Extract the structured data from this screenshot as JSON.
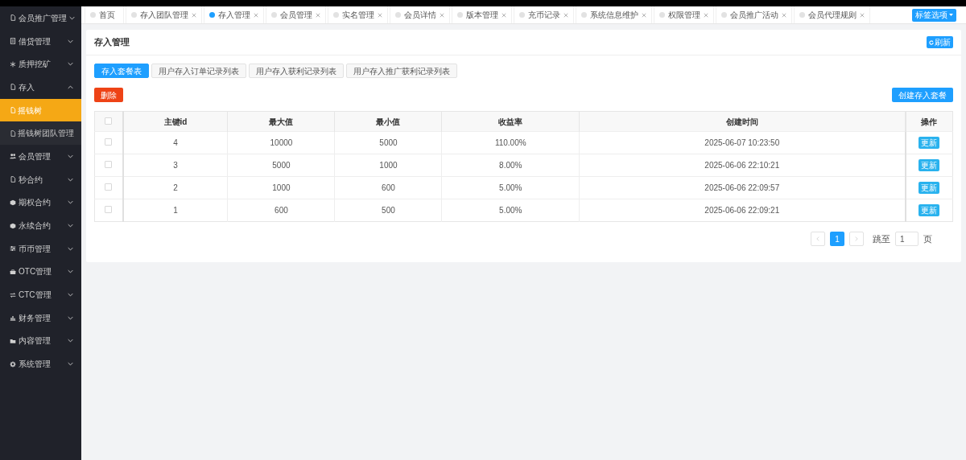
{
  "sidebar": {
    "items": [
      {
        "label": "会员推广管理",
        "kind": "file",
        "expanded": false,
        "selected": false
      },
      {
        "label": "借贷管理",
        "kind": "ledger",
        "expanded": false,
        "selected": false
      },
      {
        "label": "质押挖矿",
        "kind": "asterisk",
        "expanded": false,
        "selected": false
      },
      {
        "label": "存入",
        "kind": "file",
        "expanded": true,
        "selected": false,
        "children": [
          {
            "label": "摇钱树",
            "kind": "file",
            "selected": true
          },
          {
            "label": "摇钱树团队管理",
            "kind": "file",
            "selected": false
          }
        ]
      },
      {
        "label": "会员管理",
        "kind": "users",
        "expanded": false,
        "selected": false
      },
      {
        "label": "秒合约",
        "kind": "file",
        "expanded": false,
        "selected": false
      },
      {
        "label": "期权合约",
        "kind": "cube",
        "expanded": false,
        "selected": false
      },
      {
        "label": "永续合约",
        "kind": "cube",
        "expanded": false,
        "selected": false
      },
      {
        "label": "币币管理",
        "kind": "sliders",
        "expanded": false,
        "selected": false
      },
      {
        "label": "OTC管理",
        "kind": "briefcase",
        "expanded": false,
        "selected": false
      },
      {
        "label": "CTC管理",
        "kind": "exchange",
        "expanded": false,
        "selected": false
      },
      {
        "label": "财务管理",
        "kind": "chart",
        "expanded": false,
        "selected": false
      },
      {
        "label": "内容管理",
        "kind": "folder",
        "expanded": false,
        "selected": false
      },
      {
        "label": "系统管理",
        "kind": "gear",
        "expanded": false,
        "selected": false
      }
    ]
  },
  "tabs": [
    {
      "label": "首页",
      "selected": false,
      "closable": false
    },
    {
      "label": "存入团队管理",
      "selected": false,
      "closable": true
    },
    {
      "label": "存入管理",
      "selected": true,
      "closable": true
    },
    {
      "label": "会员管理",
      "selected": false,
      "closable": true
    },
    {
      "label": "实名管理",
      "selected": false,
      "closable": true
    },
    {
      "label": "会员详情",
      "selected": false,
      "closable": true
    },
    {
      "label": "版本管理",
      "selected": false,
      "closable": true
    },
    {
      "label": "充币记录",
      "selected": false,
      "closable": true
    },
    {
      "label": "系统信息维护",
      "selected": false,
      "closable": true
    },
    {
      "label": "权限管理",
      "selected": false,
      "closable": true
    },
    {
      "label": "会员推广活动",
      "selected": false,
      "closable": true
    },
    {
      "label": "会员代理规则",
      "selected": false,
      "closable": true
    }
  ],
  "tab_options_button": "标签选项",
  "panel": {
    "title": "存入管理",
    "refresh_button": "刷新"
  },
  "sub_tabs": [
    {
      "label": "存入套餐表",
      "selected": true
    },
    {
      "label": "用户存入订单记录列表",
      "selected": false
    },
    {
      "label": "用户存入获利记录列表",
      "selected": false
    },
    {
      "label": "用户存入推广获利记录列表",
      "selected": false
    }
  ],
  "delete_button": "删除",
  "create_button": "创建存入套餐",
  "table": {
    "all_checked": false,
    "columns": [
      "主键id",
      "最大值",
      "最小值",
      "收益率",
      "创建时间",
      "操作"
    ],
    "rows": [
      {
        "checked": false,
        "cells": [
          "4",
          "10000",
          "5000",
          "110.00%",
          "2025-06-07 10:23:50"
        ],
        "action": "更新"
      },
      {
        "checked": false,
        "cells": [
          "3",
          "5000",
          "1000",
          "8.00%",
          "2025-06-06 22:10:21"
        ],
        "action": "更新"
      },
      {
        "checked": false,
        "cells": [
          "2",
          "1000",
          "600",
          "5.00%",
          "2025-06-06 22:09:57"
        ],
        "action": "更新"
      },
      {
        "checked": false,
        "cells": [
          "1",
          "600",
          "500",
          "5.00%",
          "2025-06-06 22:09:21"
        ],
        "action": "更新"
      }
    ]
  },
  "pagination": {
    "pages": [
      {
        "label": "1",
        "selected": true
      }
    ],
    "jump_label": "跳至",
    "jump_value": "1",
    "page_suffix": "页"
  }
}
